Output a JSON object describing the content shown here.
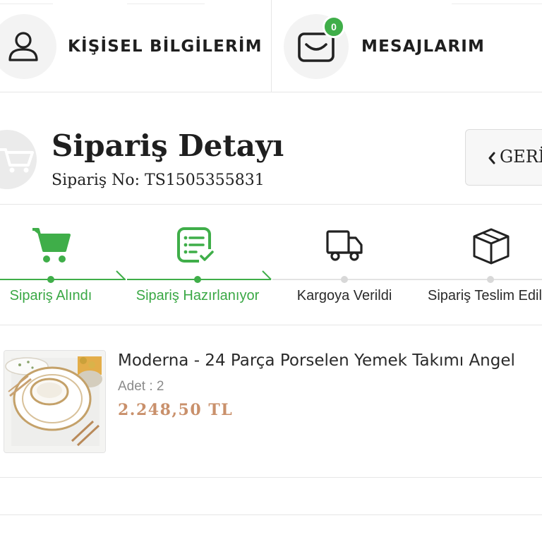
{
  "nav": {
    "profile_label": "KİŞİSEL BİLGİLERİM",
    "messages_label": "MESAJLARIM",
    "messages_badge": "0",
    "profile_icon": "user-icon",
    "messages_icon": "envelope-icon"
  },
  "order": {
    "title": "Sipariş Detayı",
    "order_no": "Sipariş No: TS1505355831",
    "back_label": "GERİ",
    "header_icon": "cart-icon"
  },
  "progress": {
    "steps": [
      {
        "label": "Sipariş Alındı",
        "status": "done",
        "icon": "cart-icon"
      },
      {
        "label": "Sipariş Hazırlanıyor",
        "status": "done",
        "icon": "checklist-icon"
      },
      {
        "label": "Kargoya Verildi",
        "status": "pending",
        "icon": "truck-icon"
      },
      {
        "label": "Sipariş Teslim Edildi",
        "status": "pending",
        "icon": "box-icon"
      }
    ]
  },
  "product": {
    "name": "Moderna - 24 Parça Porselen Yemek Takımı Angel",
    "quantity": "Adet : 2",
    "price": "2.248,50 TL"
  },
  "colors": {
    "accent_green": "#3fae49",
    "price": "#c9906b",
    "border": "#e6e6e6"
  }
}
